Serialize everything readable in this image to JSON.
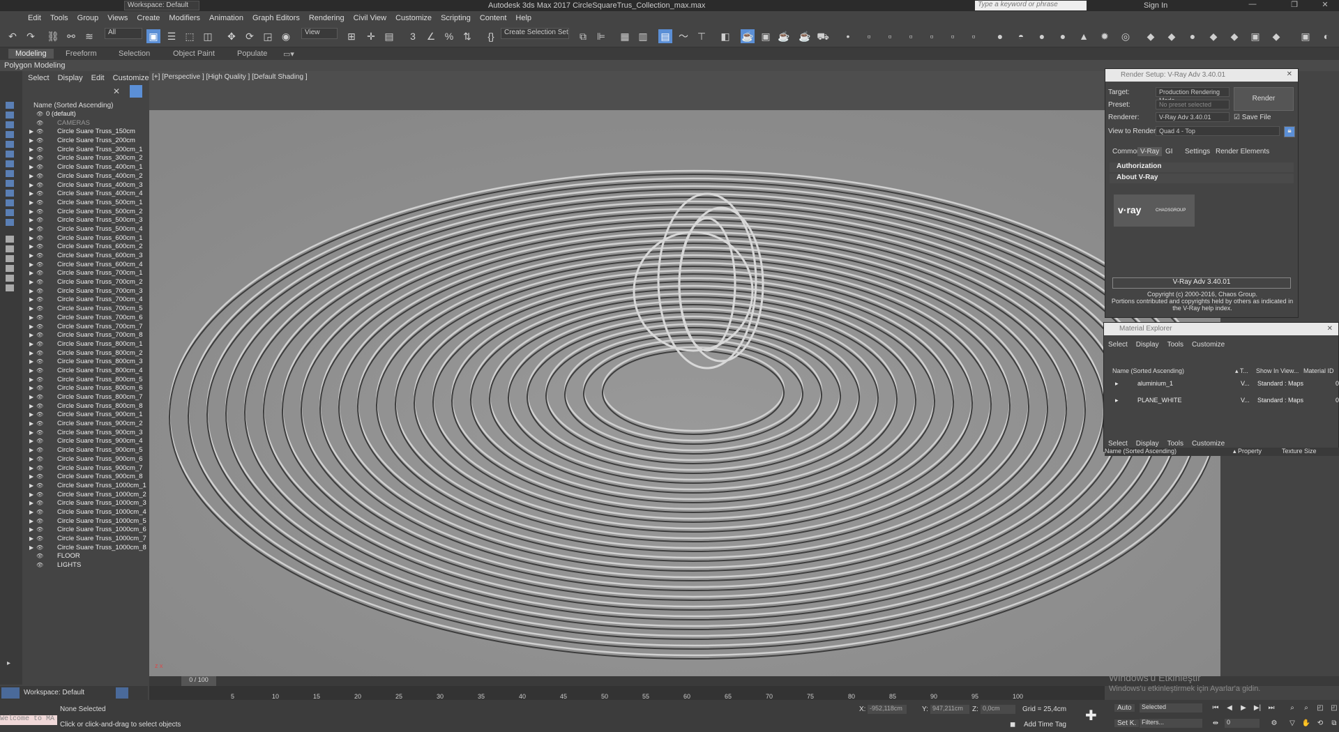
{
  "titlebar": {
    "app_title": "Autodesk 3ds Max 2017   CircleSquareTrus_Collection_max.max",
    "workspace": "Workspace: Default",
    "search_placeholder": "Type a keyword or phrase",
    "sign_in": "Sign In"
  },
  "menu": [
    "Edit",
    "Tools",
    "Group",
    "Views",
    "Create",
    "Modifiers",
    "Animation",
    "Graph Editors",
    "Rendering",
    "Civil View",
    "Customize",
    "Scripting",
    "Content",
    "Help"
  ],
  "toolbar": {
    "filter": "All",
    "view": "View",
    "selection_set": "Create Selection Set"
  },
  "ribbon": {
    "tabs": [
      "Modeling",
      "Freeform",
      "Selection",
      "Object Paint",
      "Populate"
    ],
    "active": "Modeling",
    "subtitle": "Polygon Modeling"
  },
  "explorer": {
    "menu": [
      "Select",
      "Display",
      "Edit",
      "Customize"
    ],
    "header": "Name (Sorted Ascending)",
    "items": [
      "0 (default)",
      "CAMERAS",
      "Circle Suare Truss_150cm",
      "Circle Suare Truss_200cm",
      "Circle Suare Truss_300cm_1",
      "Circle Suare Truss_300cm_2",
      "Circle Suare Truss_400cm_1",
      "Circle Suare Truss_400cm_2",
      "Circle Suare Truss_400cm_3",
      "Circle Suare Truss_400cm_4",
      "Circle Suare Truss_500cm_1",
      "Circle Suare Truss_500cm_2",
      "Circle Suare Truss_500cm_3",
      "Circle Suare Truss_500cm_4",
      "Circle Suare Truss_600cm_1",
      "Circle Suare Truss_600cm_2",
      "Circle Suare Truss_600cm_3",
      "Circle Suare Truss_600cm_4",
      "Circle Suare Truss_700cm_1",
      "Circle Suare Truss_700cm_2",
      "Circle Suare Truss_700cm_3",
      "Circle Suare Truss_700cm_4",
      "Circle Suare Truss_700cm_5",
      "Circle Suare Truss_700cm_6",
      "Circle Suare Truss_700cm_7",
      "Circle Suare Truss_700cm_8",
      "Circle Suare Truss_800cm_1",
      "Circle Suare Truss_800cm_2",
      "Circle Suare Truss_800cm_3",
      "Circle Suare Truss_800cm_4",
      "Circle Suare Truss_800cm_5",
      "Circle Suare Truss_800cm_6",
      "Circle Suare Truss_800cm_7",
      "Circle Suare Truss_800cm_8",
      "Circle Suare Truss_900cm_1",
      "Circle Suare Truss_900cm_2",
      "Circle Suare Truss_900cm_3",
      "Circle Suare Truss_900cm_4",
      "Circle Suare Truss_900cm_5",
      "Circle Suare Truss_900cm_6",
      "Circle Suare Truss_900cm_7",
      "Circle Suare Truss_900cm_8",
      "Circle Suare Truss_1000cm_1",
      "Circle Suare Truss_1000cm_2",
      "Circle Suare Truss_1000cm_3",
      "Circle Suare Truss_1000cm_4",
      "Circle Suare Truss_1000cm_5",
      "Circle Suare Truss_1000cm_6",
      "Circle Suare Truss_1000cm_7",
      "Circle Suare Truss_1000cm_8",
      "FLOOR",
      "LIGHTS"
    ],
    "workspace": "Workspace: Default"
  },
  "viewport": {
    "label": "[+] [Perspective ]  [High Quality ]  [Default Shading ]"
  },
  "render_setup": {
    "title": "Render Setup: V-Ray Adv 3.40.01",
    "target_label": "Target:",
    "target": "Production Rendering Mode",
    "preset_label": "Preset:",
    "preset": "No preset selected",
    "renderer_label": "Renderer:",
    "renderer": "V-Ray Adv 3.40.01",
    "save_file": "Save File",
    "view_label": "View to Render:",
    "view": "Quad 4 - Top",
    "render_btn": "Render",
    "tabs": [
      "Common",
      "V-Ray",
      "GI",
      "Settings",
      "Render Elements"
    ],
    "sec1": "Authorization",
    "sec2": "About V-Ray",
    "logo_text": "v·ray",
    "logo_brand": "CHAOSGROUP",
    "version": "V-Ray Adv 3.40.01",
    "copy1": "Copyright (c) 2000-2016, Chaos Group.",
    "copy2": "Portions contributed and copyrights held by others as indicated in",
    "copy3": "the V-Ray help index."
  },
  "material_explorer": {
    "title": "Material Explorer",
    "menu": [
      "Select",
      "Display",
      "Tools",
      "Customize"
    ],
    "header_name": "Name (Sorted Ascending)",
    "header_t": "▴ T...",
    "header_show": "Show In View...",
    "header_mid": "Material ID",
    "rows": [
      {
        "name": "aluminium_1",
        "v": "V...",
        "type": "Standard : Maps",
        "id": "0"
      },
      {
        "name": "PLANE_WHITE",
        "v": "V...",
        "type": "Standard : Maps",
        "id": "0"
      }
    ],
    "menu2": [
      "Select",
      "Display",
      "Tools",
      "Customize"
    ],
    "h2_name": "Name (Sorted Ascending)",
    "h2_prop": "▴ Property",
    "h2_tex": "Texture Size"
  },
  "timeline": {
    "frame": "0 / 100",
    "ticks": [
      "5",
      "10",
      "15",
      "20",
      "25",
      "30",
      "35",
      "40",
      "45",
      "50",
      "55",
      "60",
      "65",
      "70",
      "75",
      "80",
      "85",
      "90",
      "95",
      "100"
    ]
  },
  "status": {
    "maxscript": "Welcome to MA",
    "selected": "None Selected",
    "prompt": "Click or click-and-drag to select objects",
    "x_label": "X:",
    "x": "-952,118cm",
    "y_label": "Y:",
    "y": "947,211cm",
    "z_label": "Z:",
    "z": "0,0cm",
    "grid": "Grid = 25,4cm",
    "add_time_tag": "Add Time Tag",
    "auto": "Auto",
    "setk": "Set K.",
    "selected_combo": "Selected",
    "filters": "Filters...",
    "frame_field": "0"
  },
  "watermark": {
    "line1": "Windows'u Etkinleştir",
    "line2": "Windows'u etkinleştirmek için Ayarlar'a gidin."
  }
}
